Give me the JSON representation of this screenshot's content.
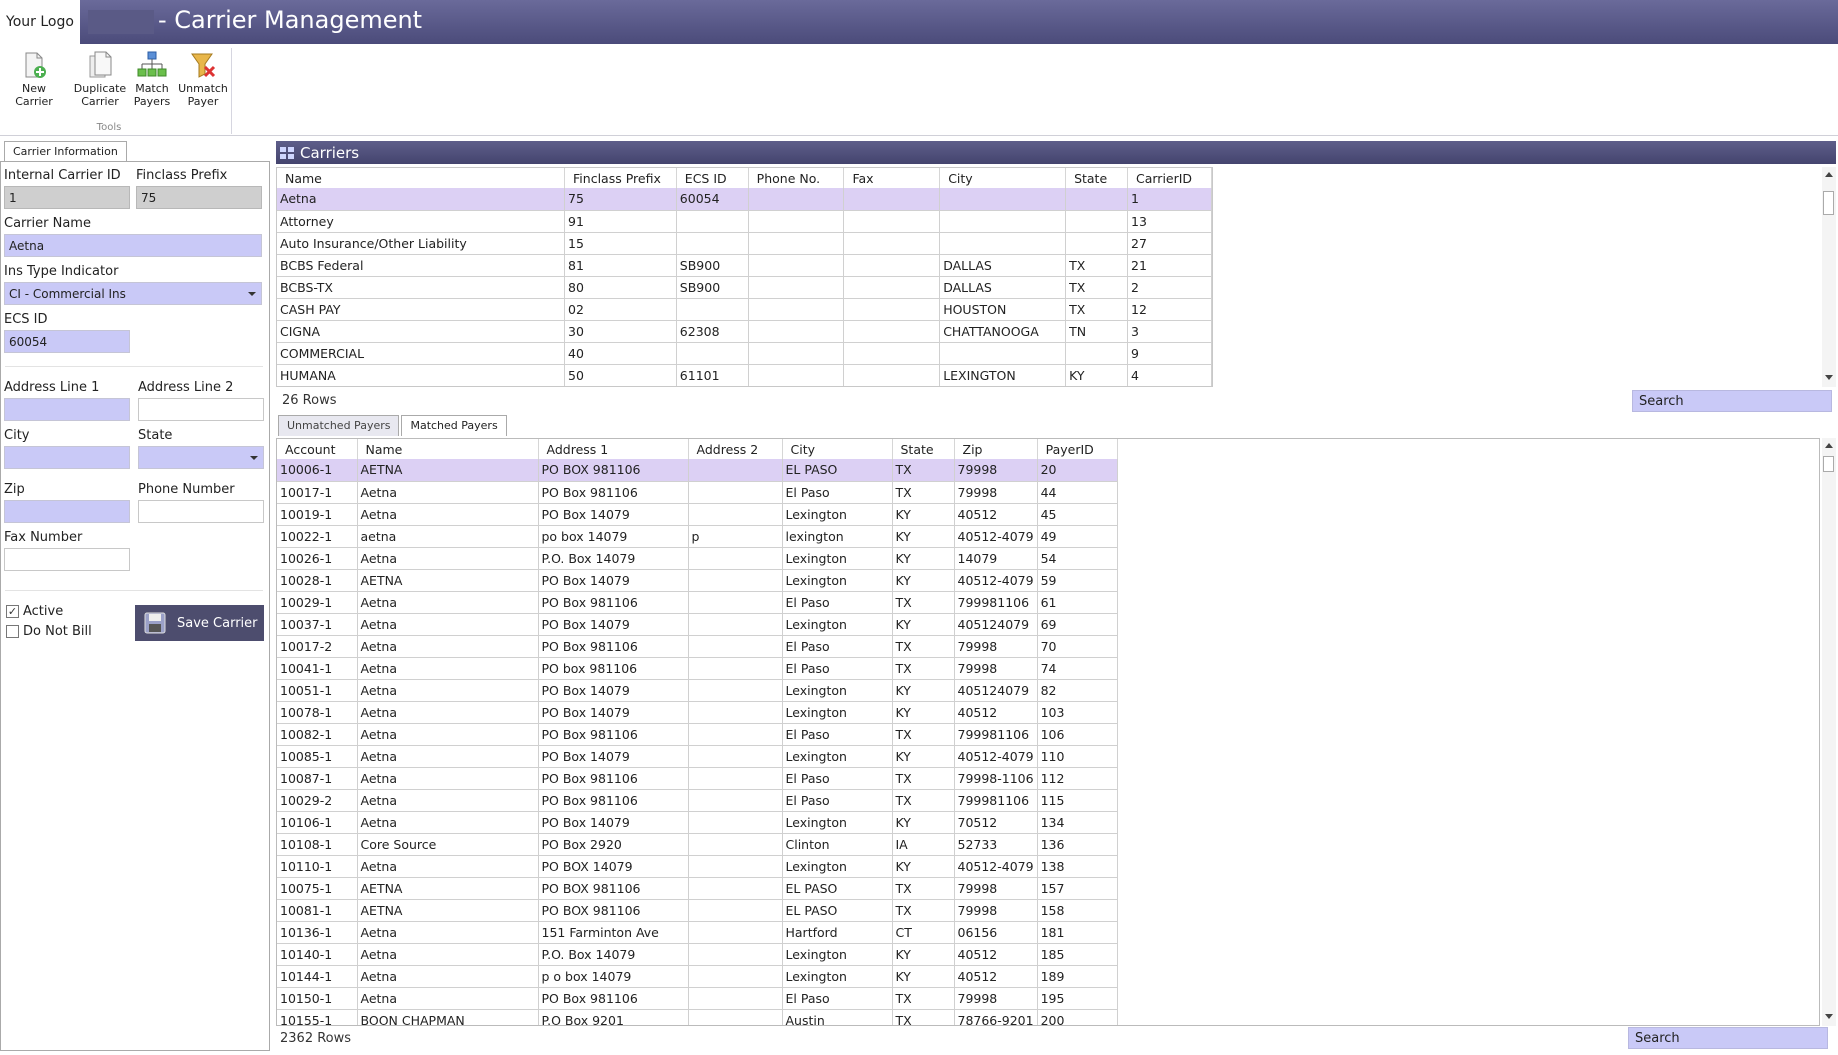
{
  "app": {
    "logo": "Your Logo",
    "title": "- Carrier Management"
  },
  "toolbar": {
    "group_label": "Tools",
    "buttons": [
      {
        "label_1": "New Carrier",
        "label_2": "",
        "icon": "new-document-icon"
      },
      {
        "label_1": "Duplicate",
        "label_2": "Carrier",
        "icon": "duplicate-document-icon"
      },
      {
        "label_1": "Match",
        "label_2": "Payers",
        "icon": "match-network-icon"
      },
      {
        "label_1": "Unmatch",
        "label_2": "Payer",
        "icon": "unmatch-funnel-icon"
      }
    ]
  },
  "left": {
    "tab": "Carrier Information",
    "internal_carrier_id": {
      "label": "Internal Carrier ID",
      "value": "1"
    },
    "finclass_prefix": {
      "label": "Finclass Prefix",
      "value": "75"
    },
    "carrier_name": {
      "label": "Carrier Name",
      "value": "Aetna"
    },
    "ins_type": {
      "label": "Ins Type Indicator",
      "value": "CI - Commercial Ins"
    },
    "ecs_id": {
      "label": "ECS ID",
      "value": "60054"
    },
    "address1": {
      "label": "Address Line 1",
      "value": ""
    },
    "address2": {
      "label": "Address Line 2",
      "value": ""
    },
    "city": {
      "label": "City",
      "value": ""
    },
    "state": {
      "label": "State",
      "value": ""
    },
    "zip": {
      "label": "Zip",
      "value": ""
    },
    "phone": {
      "label": "Phone Number",
      "value": ""
    },
    "fax": {
      "label": "Fax Number",
      "value": ""
    },
    "active": {
      "label": "Active",
      "checked": true
    },
    "do_not_bill": {
      "label": "Do Not Bill",
      "checked": false
    },
    "save_label": "Save Carrier"
  },
  "carriers": {
    "title": "Carriers",
    "columns": [
      "Name",
      "Finclass Prefix",
      "ECS ID",
      "Phone No.",
      "Fax",
      "City",
      "State",
      "CarrierID"
    ],
    "rows": [
      [
        "Aetna",
        "75",
        "60054",
        "",
        "",
        "",
        "",
        "1"
      ],
      [
        "Attorney",
        "91",
        "",
        "",
        "",
        "",
        "",
        "13"
      ],
      [
        "Auto Insurance/Other Liability",
        "15",
        "",
        "",
        "",
        "",
        "",
        "27"
      ],
      [
        "BCBS Federal",
        "81",
        "SB900",
        "",
        "",
        "DALLAS",
        "TX",
        "21"
      ],
      [
        "BCBS-TX",
        "80",
        "SB900",
        "",
        "",
        "DALLAS",
        "TX",
        "2"
      ],
      [
        "CASH PAY",
        "02",
        "",
        "",
        "",
        "HOUSTON",
        "TX",
        "12"
      ],
      [
        "CIGNA",
        "30",
        "62308",
        "",
        "",
        "CHATTANOOGA",
        "TN",
        "3"
      ],
      [
        "COMMERCIAL",
        "40",
        "",
        "",
        "",
        "",
        "",
        "9"
      ],
      [
        "HUMANA",
        "50",
        "61101",
        "",
        "",
        "LEXINGTON",
        "KY",
        "4"
      ]
    ],
    "row_count": "26 Rows",
    "search_placeholder": "Search"
  },
  "payers": {
    "tabs": [
      "Unmatched Payers",
      "Matched Payers"
    ],
    "columns": [
      "Account",
      "Name",
      "Address 1",
      "Address 2",
      "City",
      "State",
      "Zip",
      "PayerID"
    ],
    "rows": [
      [
        "10006-1",
        "AETNA",
        "PO BOX 981106",
        "",
        "EL PASO",
        "TX",
        "79998",
        "20"
      ],
      [
        "10017-1",
        "Aetna",
        "PO Box 981106",
        "",
        "El Paso",
        "TX",
        "79998",
        "44"
      ],
      [
        "10019-1",
        "Aetna",
        "PO Box 14079",
        "",
        "Lexington",
        "KY",
        "40512",
        "45"
      ],
      [
        "10022-1",
        "aetna",
        "po box 14079",
        "p",
        "lexington",
        "KY",
        "40512-4079",
        "49"
      ],
      [
        "10026-1",
        "Aetna",
        "P.O. Box 14079",
        "",
        "Lexington",
        "KY",
        "14079",
        "54"
      ],
      [
        "10028-1",
        "AETNA",
        "PO Box 14079",
        "",
        "Lexington",
        "KY",
        "40512-4079",
        "59"
      ],
      [
        "10029-1",
        "Aetna",
        "PO Box 981106",
        "",
        "El Paso",
        "TX",
        "799981106",
        "61"
      ],
      [
        "10037-1",
        "Aetna",
        "PO Box 14079",
        "",
        "Lexington",
        "KY",
        "405124079",
        "69"
      ],
      [
        "10017-2",
        "Aetna",
        "PO Box 981106",
        "",
        "El Paso",
        "TX",
        "79998",
        "70"
      ],
      [
        "10041-1",
        "Aetna",
        "PO box 981106",
        "",
        "El Paso",
        "TX",
        "79998",
        "74"
      ],
      [
        "10051-1",
        "Aetna",
        "PO Box 14079",
        "",
        "Lexington",
        "KY",
        "405124079",
        "82"
      ],
      [
        "10078-1",
        "Aetna",
        "PO Box 14079",
        "",
        "Lexington",
        "KY",
        "40512",
        "103"
      ],
      [
        "10082-1",
        "Aetna",
        "PO Box 981106",
        "",
        "El Paso",
        "TX",
        "799981106",
        "106"
      ],
      [
        "10085-1",
        "Aetna",
        "PO Box 14079",
        "",
        "Lexington",
        "KY",
        "40512-4079",
        "110"
      ],
      [
        "10087-1",
        "Aetna",
        "PO Box 981106",
        "",
        "El Paso",
        "TX",
        "79998-1106",
        "112"
      ],
      [
        "10029-2",
        "Aetna",
        "PO Box 981106",
        "",
        "El Paso",
        "TX",
        "799981106",
        "115"
      ],
      [
        "10106-1",
        "Aetna",
        "PO Box 14079",
        "",
        "Lexington",
        "KY",
        "70512",
        "134"
      ],
      [
        "10108-1",
        "Core Source",
        "PO Box 2920",
        "",
        "Clinton",
        "IA",
        "52733",
        "136"
      ],
      [
        "10110-1",
        "Aetna",
        "PO BOX 14079",
        "",
        "Lexington",
        "KY",
        "40512-4079",
        "138"
      ],
      [
        "10075-1",
        "AETNA",
        "PO BOX 981106",
        "",
        "EL PASO",
        "TX",
        "79998",
        "157"
      ],
      [
        "10081-1",
        "AETNA",
        "PO BOX 981106",
        "",
        "EL PASO",
        "TX",
        "79998",
        "158"
      ],
      [
        "10136-1",
        "Aetna",
        "151 Farminton Ave",
        "",
        "Hartford",
        "CT",
        "06156",
        "181"
      ],
      [
        "10140-1",
        "Aetna",
        "P.O. Box 14079",
        "",
        "Lexington",
        "KY",
        "40512",
        "185"
      ],
      [
        "10144-1",
        "Aetna",
        "p o box 14079",
        "",
        "Lexington",
        "KY",
        "40512",
        "189"
      ],
      [
        "10150-1",
        "Aetna",
        "PO Box 981106",
        "",
        "El Paso",
        "TX",
        "79998",
        "195"
      ],
      [
        "10155-1",
        "BOON CHAPMAN",
        "P.O Box 9201",
        "",
        "Austin",
        "TX",
        "78766-9201",
        "200"
      ]
    ],
    "row_count": "2362 Rows",
    "search_placeholder": "Search"
  },
  "colors": {
    "title_bar": "#4b4b7a",
    "input_fill": "#c9c9f7",
    "selected_row": "#dcd0f4"
  }
}
